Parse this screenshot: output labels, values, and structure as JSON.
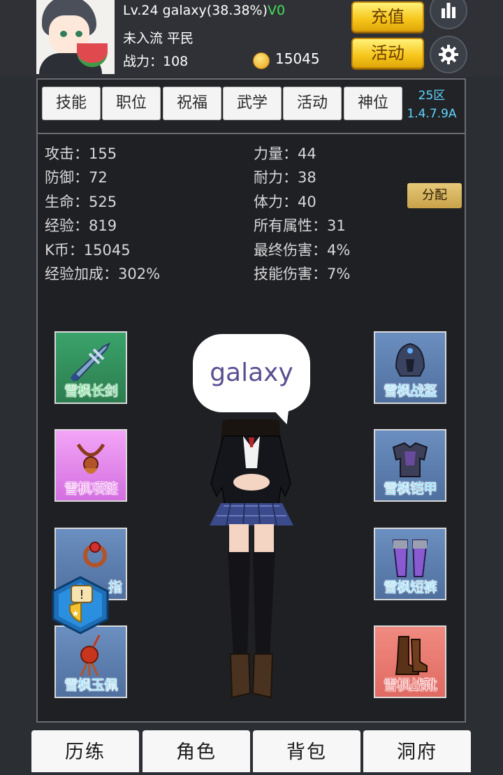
{
  "player": {
    "level_line": "Lv.24 galaxy(38.38%)",
    "vip": "V0",
    "rank_line": "未入流 平民",
    "power_line": "战力：108",
    "coins": "15045"
  },
  "buttons": {
    "recharge": "充值",
    "events": "活动"
  },
  "tabs": [
    "技能",
    "职位",
    "祝福",
    "武学",
    "活动",
    "神位"
  ],
  "server": {
    "zone": "25区",
    "version": "1.4.7.9A"
  },
  "stats_left": [
    "攻击：155",
    "防御：72",
    "生命：525",
    "经验：819",
    "K币：15045",
    "经验加成：302%"
  ],
  "stats_right": [
    "力量：44",
    "耐力：38",
    "体力：40",
    "所有属性：31",
    "最终伤害：4%",
    "技能伤害：7%"
  ],
  "assign_label": "分配",
  "equipment": {
    "sword": "雪枫长剑",
    "necklace": "雪枫项链",
    "ring": "指",
    "pendant": "雪枫玉佩",
    "helmet": "雪枫战盔",
    "armor": "雪枫铠甲",
    "pants": "雪枫短裤",
    "boots": "雪枫战靴"
  },
  "speech": "galaxy",
  "nav": [
    "历练",
    "角色",
    "背包",
    "洞府"
  ],
  "colors": {
    "vip": "#44e05a",
    "server": "#5fd6ff",
    "gold": "#f6c51a",
    "uncommon": "#3fd96a",
    "rare": "#5fd6ff",
    "epic": "#e04ae0",
    "legendary": "#e02424"
  }
}
